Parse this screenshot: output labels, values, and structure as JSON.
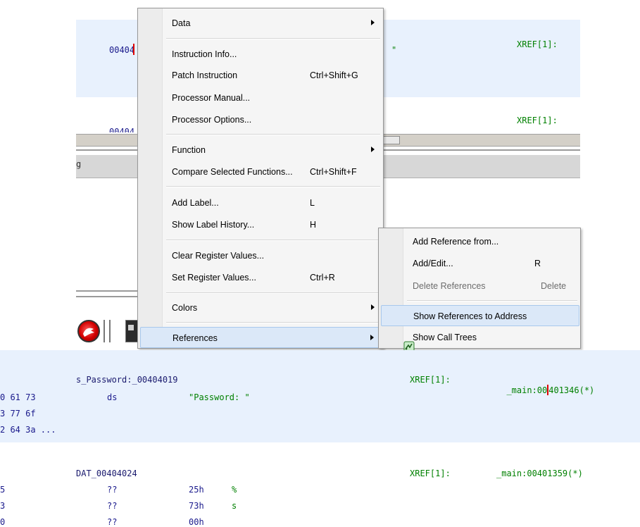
{
  "listing_top": {
    "addr1": "00404",
    "addr2": "00404",
    "quote": "\"",
    "xref1": "XREF[1]:",
    "xref2": "XREF[1]:",
    "side_mark": "g"
  },
  "listing_bottom": {
    "label1": "s_Password:_00404019",
    "xref1": "XREF[1]:",
    "ref1_a": "_main:00",
    "ref1_b": "401346(*)",
    "bytes": [
      "0 61 73",
      "3 77 6f",
      "2 64 3a ..."
    ],
    "ds": "ds",
    "string": "\"Password: \"",
    "label2": "DAT_00404024",
    "xref2": "XREF[1]:",
    "ref2": "_main:00401359(*)",
    "rows": [
      {
        "b": "5",
        "m": "??",
        "v": "25h",
        "c": "%"
      },
      {
        "b": "3",
        "m": "??",
        "v": "73h",
        "c": "s"
      },
      {
        "b": "0",
        "m": "??",
        "v": "00h",
        "c": ""
      }
    ]
  },
  "context_menu": {
    "data": "Data",
    "instruction_info": "Instruction Info...",
    "patch_instruction": "Patch Instruction",
    "patch_shortcut": "Ctrl+Shift+G",
    "processor_manual": "Processor Manual...",
    "processor_options": "Processor Options...",
    "function": "Function",
    "compare_functions": "Compare Selected Functions...",
    "compare_shortcut": "Ctrl+Shift+F",
    "add_label": "Add Label...",
    "add_label_shortcut": "L",
    "show_label_history": "Show Label History...",
    "label_history_shortcut": "H",
    "clear_register": "Clear Register Values...",
    "set_register": "Set Register Values...",
    "set_register_shortcut": "Ctrl+R",
    "colors": "Colors",
    "references": "References"
  },
  "submenu": {
    "add_reference_from": "Add Reference from...",
    "add_edit": "Add/Edit...",
    "add_edit_shortcut": "R",
    "delete_references": "Delete References",
    "delete_shortcut": "Delete",
    "show_references": "Show References to Address",
    "show_call_trees": "Show Call Trees"
  },
  "icons": {
    "app": "ghidra-dragon-icon",
    "console": "console-icon",
    "call_tree": "call-tree-icon"
  },
  "colors": {
    "xref_green": "#008000",
    "highlight_bg": "#e8f1fd",
    "cursor_red": "#e00000"
  }
}
